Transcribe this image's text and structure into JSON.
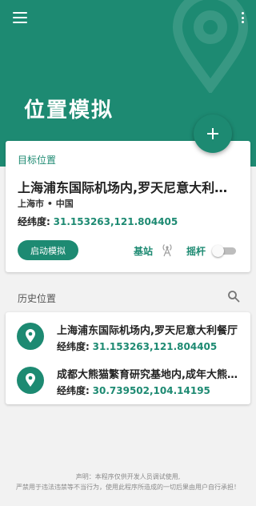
{
  "header": {
    "title": "位置模拟",
    "menu_icon": "hamburger-menu-icon",
    "more_icon": "more-vertical-icon",
    "decor_icon": "location-pin-outline-icon"
  },
  "fab": {
    "icon": "plus-icon"
  },
  "target": {
    "section_label": "目标位置",
    "name": "上海浦东国际机场内,罗天尼意大利餐厅",
    "region": "上海市 • 中国",
    "coord_label": "经纬度:",
    "coord_value": "31.153263,121.804405",
    "start_button": "启动模拟",
    "base_station_label": "基站",
    "base_station_icon": "antenna-icon",
    "joystick_label": "摇杆",
    "joystick_enabled": false
  },
  "history": {
    "section_label": "历史位置",
    "search_icon": "search-icon",
    "items": [
      {
        "name": "上海浦东国际机场内,罗天尼意大利餐厅",
        "coord_label": "经纬度:",
        "coord_value": "31.153263,121.804405",
        "icon": "location-pin-icon"
      },
      {
        "name": "成都大熊猫繁育研究基地内,成年大熊猫馆",
        "coord_label": "经纬度:",
        "coord_value": "30.739502,104.14195",
        "icon": "location-pin-icon"
      }
    ]
  },
  "footer": {
    "line1": "声明：本程序仅供开发人员调试使用,",
    "line2": "严禁用于违法违禁等不当行为，使用此程序所造成的一切后果由用户自行承担！"
  },
  "colors": {
    "primary": "#1d8a72",
    "background": "#f2f2f2",
    "card": "#ffffff",
    "text": "#222222",
    "muted": "#8a8a8a"
  }
}
